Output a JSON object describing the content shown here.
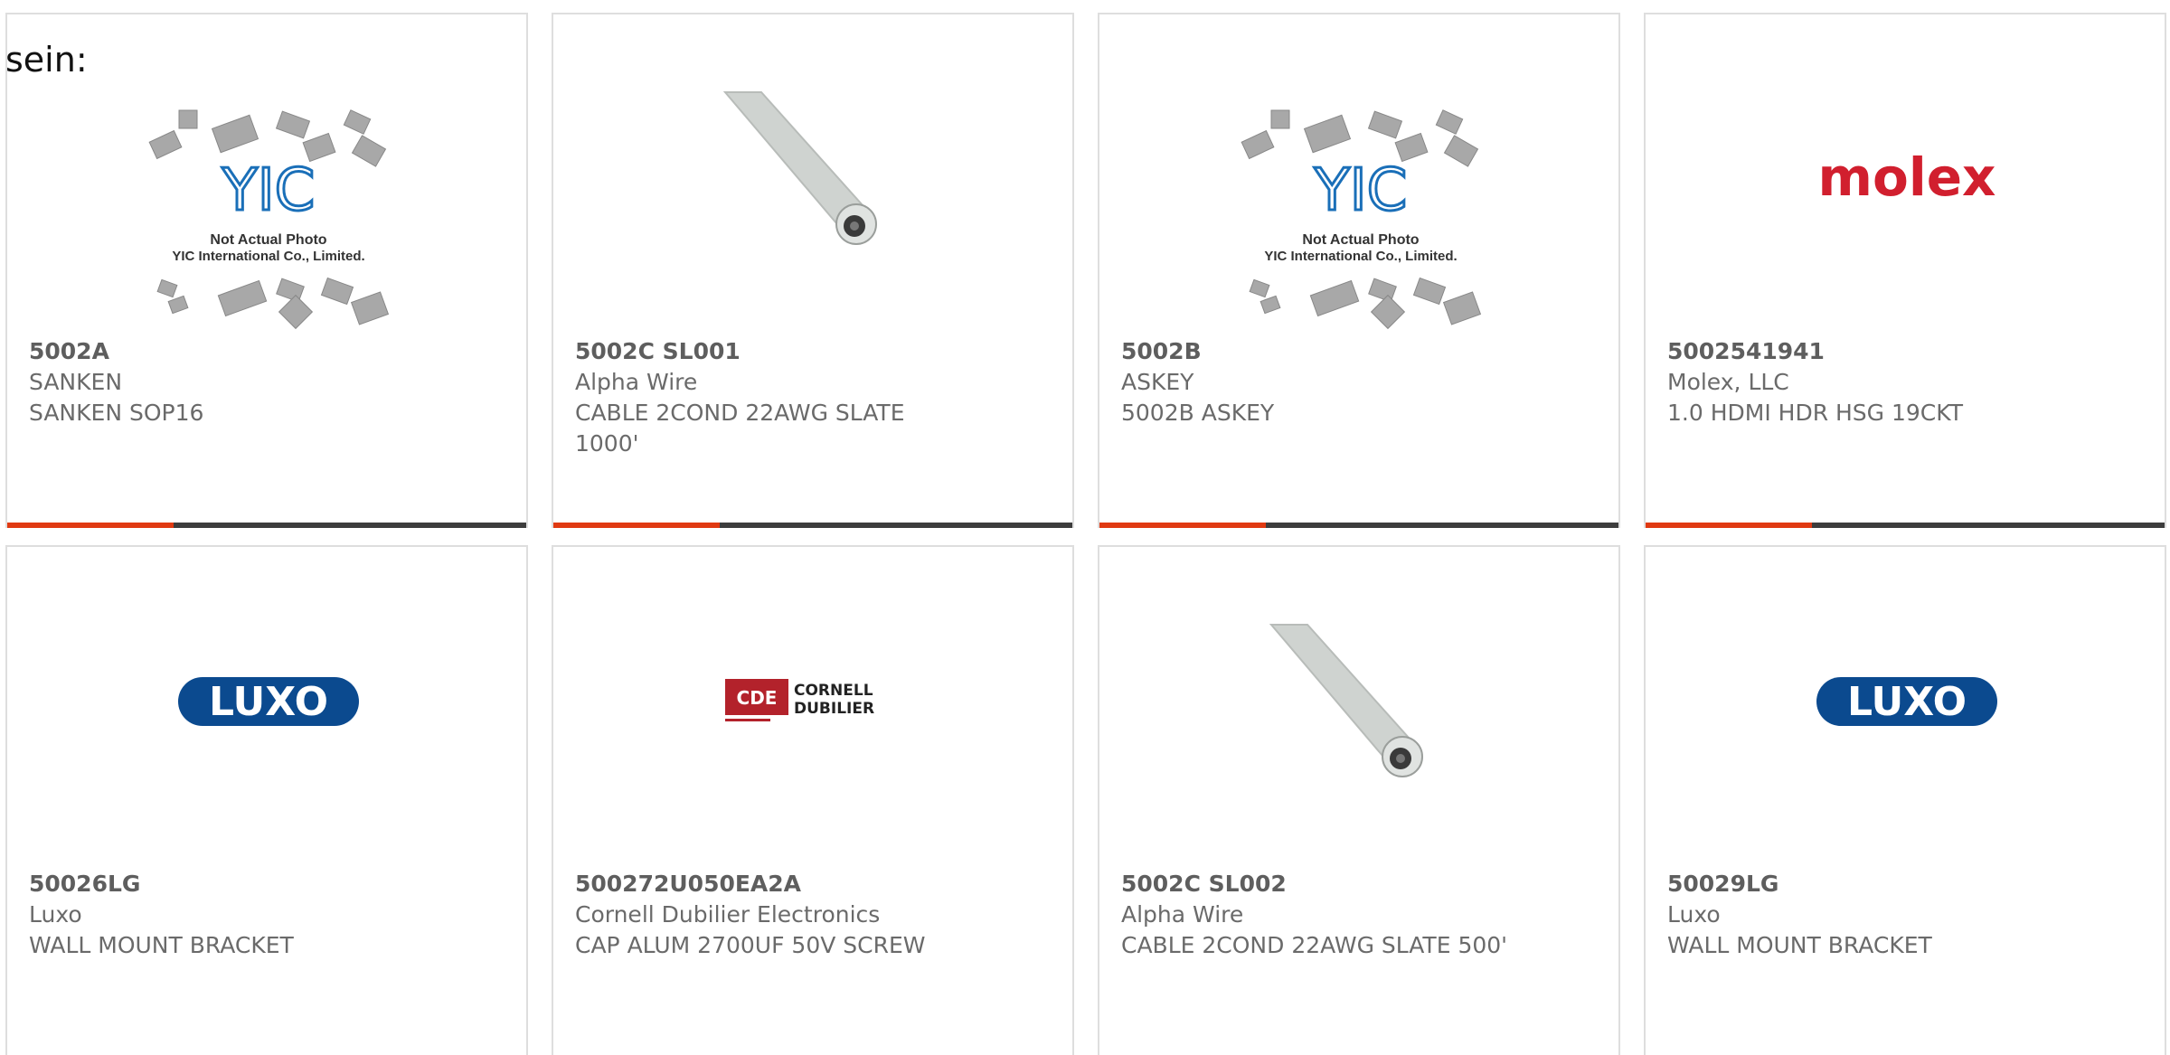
{
  "page": {
    "intro_text": "sein:",
    "accent_color": "#e03a12",
    "bar_color": "#3d3d3d"
  },
  "products": [
    {
      "part_number": "5002A",
      "manufacturer": "SANKEN",
      "description": "SANKEN SOP16",
      "image": "yic-placeholder",
      "image_text_1": "Not Actual Photo",
      "image_text_2": "YIC International Co., Limited.",
      "image_logo_text": "YIC"
    },
    {
      "part_number": "5002C SL001",
      "manufacturer": "Alpha Wire",
      "description": "CABLE 2COND 22AWG SLATE 1000'",
      "image": "grey-cable"
    },
    {
      "part_number": "5002B",
      "manufacturer": "ASKEY",
      "description": "5002B ASKEY",
      "image": "yic-placeholder",
      "image_text_1": "Not Actual Photo",
      "image_text_2": "YIC International Co., Limited.",
      "image_logo_text": "YIC"
    },
    {
      "part_number": "5002541941",
      "manufacturer": "Molex, LLC",
      "description": "1.0 HDMI HDR HSG 19CKT",
      "image": "molex-logo",
      "image_logo_text": "molex"
    },
    {
      "part_number": "50026LG",
      "manufacturer": "Luxo",
      "description": "WALL MOUNT BRACKET",
      "image": "luxo-logo",
      "image_logo_text": "LUXO"
    },
    {
      "part_number": "500272U050EA2A",
      "manufacturer": "Cornell Dubilier Electronics",
      "description": "CAP ALUM 2700UF 50V SCREW",
      "image": "cde-logo",
      "image_logo_text": "CDE",
      "image_logo_name_1": "CORNELL",
      "image_logo_name_2": "DUBILIER"
    },
    {
      "part_number": "5002C SL002",
      "manufacturer": "Alpha Wire",
      "description": "CABLE 2COND 22AWG SLATE 500'",
      "image": "grey-cable"
    },
    {
      "part_number": "50029LG",
      "manufacturer": "Luxo",
      "description": "WALL MOUNT BRACKET",
      "image": "luxo-logo",
      "image_logo_text": "LUXO"
    }
  ]
}
